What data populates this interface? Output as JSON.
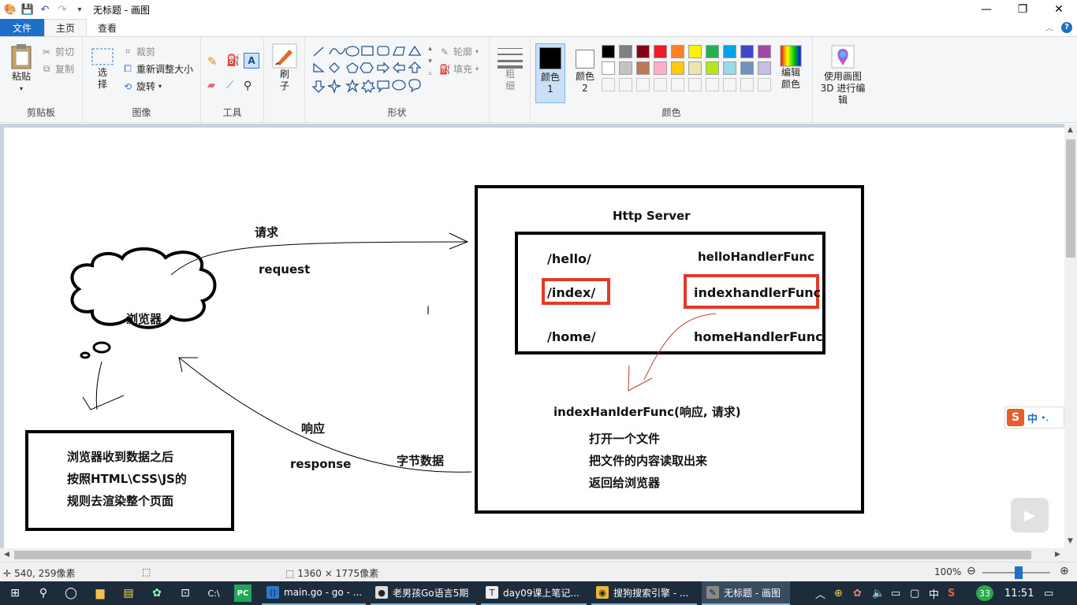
{
  "window": {
    "title": "无标题 - 画图",
    "controls": {
      "minimize": "—",
      "maximize": "❐",
      "close": "✕"
    }
  },
  "menu": {
    "file": "文件",
    "tabs": [
      "主页",
      "查看"
    ],
    "help": "?"
  },
  "ribbon": {
    "clipboard": {
      "label": "剪贴板",
      "paste": "粘贴",
      "cut": "剪切",
      "copy": "复制"
    },
    "image": {
      "label": "图像",
      "select": "选择",
      "crop": "裁剪",
      "resize": "重新调整大小",
      "rotate": "旋转"
    },
    "tools": {
      "label": "工具"
    },
    "brushes": {
      "label": "刷子"
    },
    "shapes": {
      "label": "形状",
      "outline": "轮廓",
      "fill": "填充"
    },
    "size": {
      "label": "粗细"
    },
    "colors": {
      "label": "颜色",
      "color1": "颜色 1",
      "color2": "颜色 2",
      "edit": "编辑颜色",
      "color1_value": "#000000",
      "color2_value": "#ffffff",
      "palette_row1": [
        "#000000",
        "#7f7f7f",
        "#880015",
        "#ed1c24",
        "#ff7f27",
        "#fff200",
        "#22b14c",
        "#00a2e8",
        "#3f48cc",
        "#a349a4"
      ],
      "palette_row2": [
        "#ffffff",
        "#c3c3c3",
        "#b97a57",
        "#ffaec9",
        "#ffc90e",
        "#efe4b0",
        "#b5e61d",
        "#99d9ea",
        "#7092be",
        "#c8bfe7"
      ]
    },
    "paint3d": {
      "label": "使用画图 3D 进行编辑"
    }
  },
  "canvas": {
    "request_cn": "请求",
    "request_en": "request",
    "browser": "浏览器",
    "response_cn": "响应",
    "response_en": "response",
    "bytes": "字节数据",
    "server_title": "Http Server",
    "routes": [
      {
        "path": "/hello/",
        "handler": "helloHandlerFunc"
      },
      {
        "path": "/index/",
        "handler": "indexhandlerFunc"
      },
      {
        "path": "/home/",
        "handler": "homeHandlerFunc"
      }
    ],
    "func_sig": "indexHanlderFunc(响应, 请求)",
    "steps": [
      "打开一个文件",
      "把文件的内容读取出来",
      "返回给浏览器"
    ],
    "note": [
      "浏览器收到数据之后",
      "按照HTML\\CSS\\JS的",
      "规则去渲染整个页面"
    ]
  },
  "status": {
    "cursor_pos": "540, 259像素",
    "image_size": "1360 × 1775像素",
    "zoom": "100%"
  },
  "taskbar": {
    "apps": [
      {
        "label": "main.go - go - ...",
        "icon": "vscode-icon"
      },
      {
        "label": "老男孩Go语言5期",
        "icon": "player-icon"
      },
      {
        "label": "day09课上笔记...",
        "icon": "typora-icon"
      },
      {
        "label": "搜狗搜索引擎 - ...",
        "icon": "chrome-icon"
      },
      {
        "label": "无标题 - 画图",
        "icon": "paint-icon"
      }
    ],
    "tray": {
      "ime": "中",
      "badge": "33",
      "time": "11:51"
    }
  },
  "ime_widget": {
    "label": "中"
  }
}
